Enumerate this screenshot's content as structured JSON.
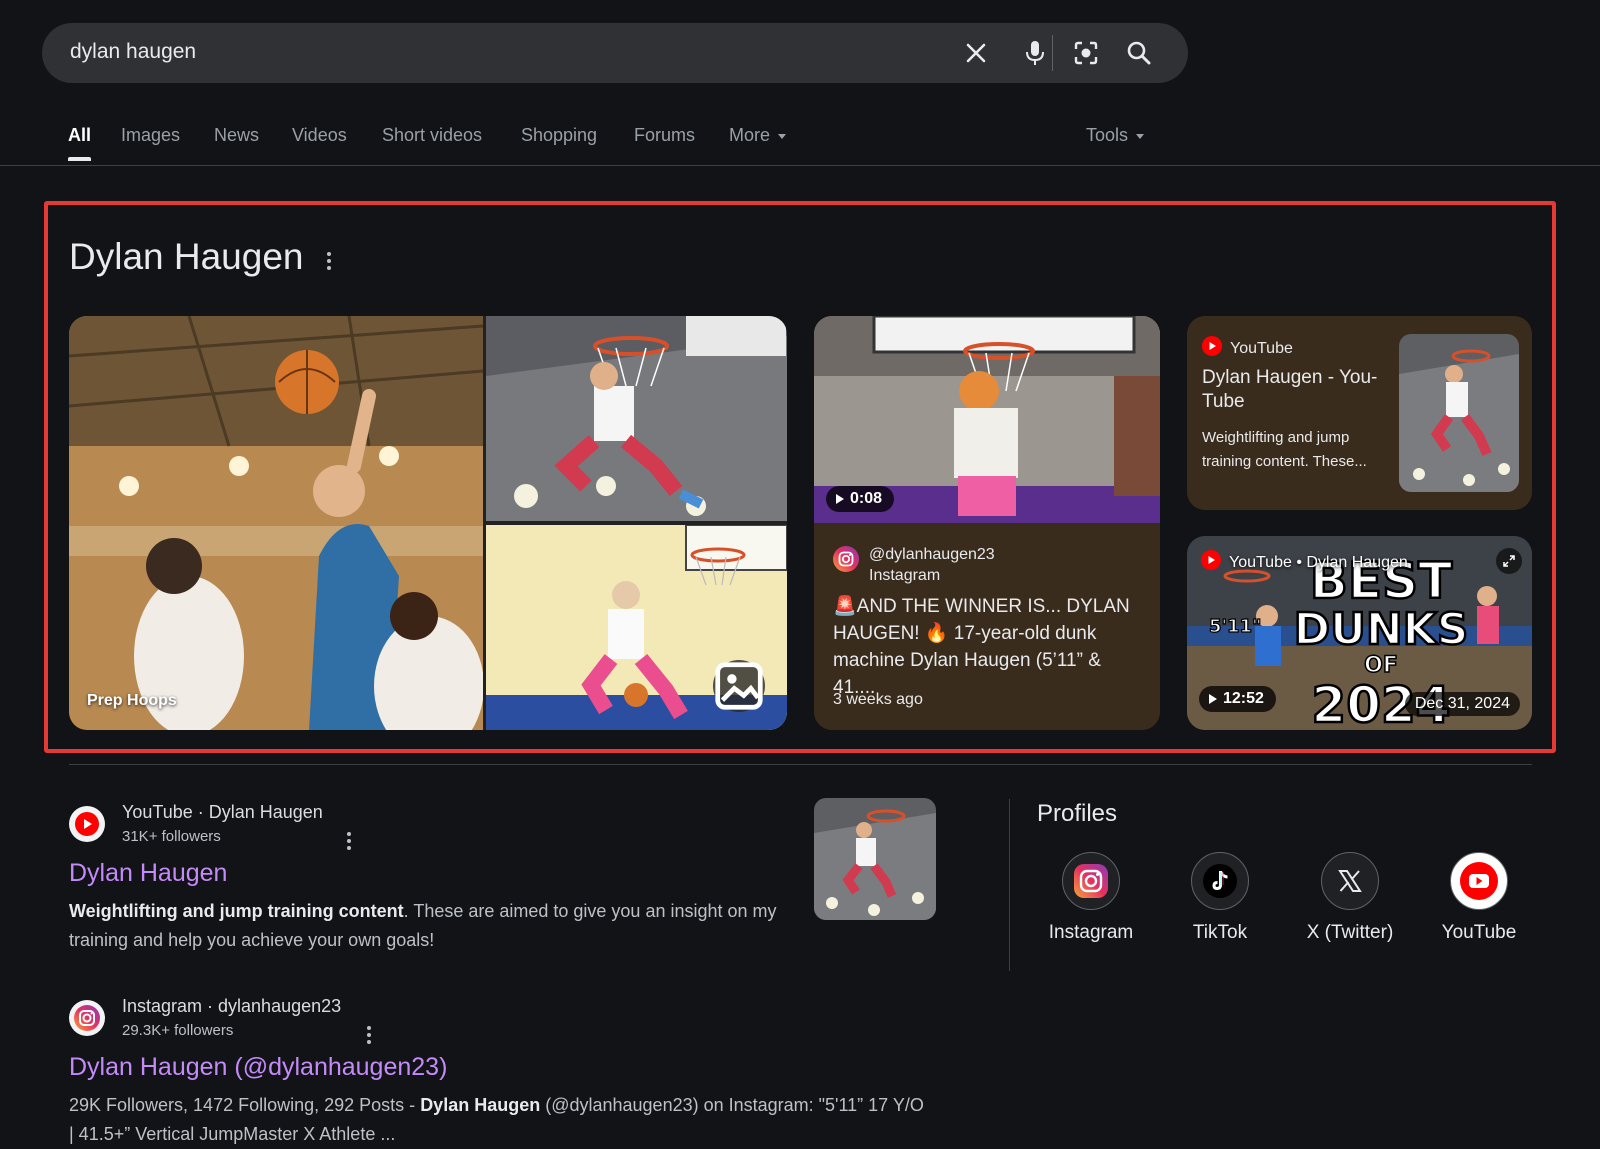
{
  "search": {
    "query": "dylan haugen"
  },
  "tabs": {
    "items": [
      {
        "label": "All",
        "active": true
      },
      {
        "label": "Images"
      },
      {
        "label": "News"
      },
      {
        "label": "Videos"
      },
      {
        "label": "Short videos"
      },
      {
        "label": "Shopping"
      },
      {
        "label": "Forums"
      },
      {
        "label": "More"
      }
    ],
    "tools": "Tools"
  },
  "entity": {
    "title": "Dylan Haugen"
  },
  "collage": {
    "caption": "Prep Hoops"
  },
  "instagram_card": {
    "duration": "0:08",
    "handle": "@dylanhaugen23",
    "platform": "Instagram",
    "text": "🚨AND THE WINNER IS... DYLAN HAUGEN! 🔥 17-year-old dunk machine Dylan Haugen (5’11” & 41....",
    "time": "3 weeks ago"
  },
  "youtube_card": {
    "source": "YouTube",
    "title": "Dylan Haugen - You-Tube",
    "snippet": "Weightlifting and jump training content. These..."
  },
  "dunks_card": {
    "source": "YouTube • Dylan Haugen",
    "duration": "12:52",
    "date": "Dec 31, 2024",
    "overlay_lines": [
      "BEST",
      "DUNKS",
      "OF",
      "2024"
    ],
    "overlay_height": "5'11\""
  },
  "result1": {
    "site": "YouTube · Dylan Haugen",
    "followers": "31K+ followers",
    "title": "Dylan Haugen",
    "snippet_bold": "Weightlifting and jump training content",
    "snippet_rest": ". These are aimed to give you an insight on my training and help you achieve your own goals!"
  },
  "result2": {
    "site": "Instagram · dylanhaugen23",
    "followers": "29.3K+ followers",
    "title": "Dylan Haugen (@dylanhaugen23)",
    "snippet_pre": "29K Followers, 1472 Following, 292 Posts - ",
    "snippet_bold": "Dylan Haugen",
    "snippet_post": " (@dylanhaugen23) on Instagram: \"5'11” 17 Y/O | 41.5+” Vertical JumpMaster X Athlete ..."
  },
  "profiles": {
    "title": "Profiles",
    "items": [
      {
        "label": "Instagram",
        "icon": "instagram-icon"
      },
      {
        "label": "TikTok",
        "icon": "tiktok-icon"
      },
      {
        "label": "X (Twitter)",
        "icon": "x-icon"
      },
      {
        "label": "YouTube",
        "icon": "youtube-icon"
      }
    ]
  },
  "colors": {
    "background": "#111317",
    "searchbar": "#303134",
    "link": "#c58af9",
    "highlight": "#e53935",
    "card": "#3a2c1c"
  }
}
